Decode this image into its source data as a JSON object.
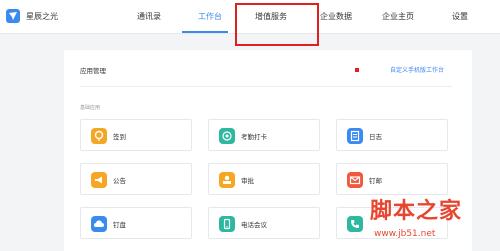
{
  "header": {
    "company_name": "星辰之光",
    "nav": [
      {
        "label": "通讯录",
        "active": false
      },
      {
        "label": "工作台",
        "active": true
      },
      {
        "label": "增值服务",
        "active": false
      },
      {
        "label": "企业数据",
        "active": false
      },
      {
        "label": "企业主页",
        "active": false
      },
      {
        "label": "设置",
        "active": false
      }
    ]
  },
  "main": {
    "section_title": "应用管理",
    "customize_link": "自定义手机版工作台",
    "subsection_title": "基础应用",
    "apps": [
      {
        "label": "签到",
        "icon": "location-pin-icon",
        "color": "#f5a623"
      },
      {
        "label": "考勤打卡",
        "icon": "fingerprint-icon",
        "color": "#2fb8a0"
      },
      {
        "label": "日志",
        "icon": "document-icon",
        "color": "#3b8af0"
      },
      {
        "label": "公告",
        "icon": "megaphone-icon",
        "color": "#f5a623"
      },
      {
        "label": "审批",
        "icon": "stamp-icon",
        "color": "#f5a623"
      },
      {
        "label": "钉邮",
        "icon": "mail-icon",
        "color": "#f05a3c"
      },
      {
        "label": "钉盘",
        "icon": "cloud-icon",
        "color": "#3b8af0"
      },
      {
        "label": "电话会议",
        "icon": "phone-icon",
        "color": "#2fb8a0"
      },
      {
        "label": "",
        "icon": "phone-call-icon",
        "color": "#2fb8a0"
      }
    ]
  },
  "watermark": {
    "title": "脚本之家",
    "url": "www.jb51.net"
  },
  "colors": {
    "accent": "#3b8af0",
    "highlight": "#e02020"
  }
}
